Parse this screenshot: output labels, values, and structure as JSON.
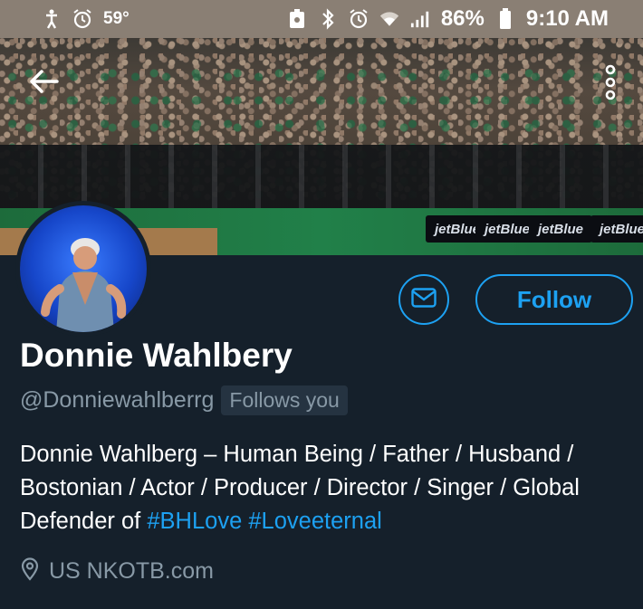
{
  "status_bar": {
    "temperature": "59°",
    "battery": "86%",
    "time": "9:10 AM"
  },
  "banner": {
    "boards": [
      "jetBlue",
      "jetBlue",
      "jetBlue",
      "jetBlue"
    ]
  },
  "profile": {
    "display_name": "Donnie Wahlbery",
    "handle": "@Donniewahlberrg",
    "follows_you": "Follows you",
    "follow_label": "Follow",
    "bio_text": "Donnie Wahlberg – Human Being / Father / Husband / Bostonian / Actor / Producer / Director / Singer / Global Defender of ",
    "hashtags": [
      "#BHLove",
      "#Loveeternal"
    ],
    "location": "US NKOTB.com"
  },
  "colors": {
    "background": "#15202b",
    "accent": "#1da1f2",
    "muted": "#8899a6"
  },
  "icons": {
    "back": "back-arrow-icon",
    "more": "more-vertical-icon",
    "message": "envelope-icon",
    "location": "location-pin-icon"
  }
}
